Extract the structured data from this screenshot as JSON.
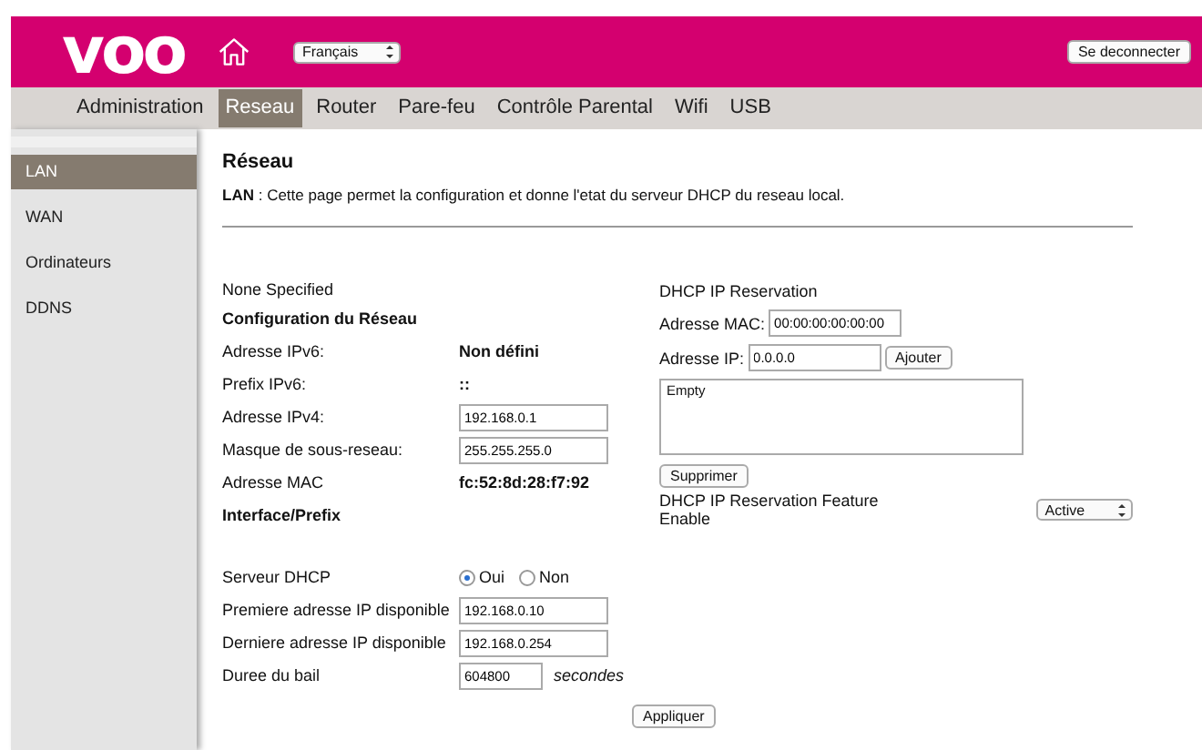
{
  "header": {
    "logo": "voo",
    "language": "Français",
    "logout": "Se deconnecter"
  },
  "tabs": [
    {
      "label": "Administration",
      "selected": false
    },
    {
      "label": "Reseau",
      "selected": true
    },
    {
      "label": "Router",
      "selected": false
    },
    {
      "label": "Pare-feu",
      "selected": false
    },
    {
      "label": "Contrôle Parental",
      "selected": false
    },
    {
      "label": "Wifi",
      "selected": false
    },
    {
      "label": "USB",
      "selected": false
    }
  ],
  "sidebar": {
    "items": [
      {
        "label": "LAN",
        "selected": true
      },
      {
        "label": "WAN",
        "selected": false
      },
      {
        "label": "Ordinateurs",
        "selected": false
      },
      {
        "label": "DDNS",
        "selected": false
      }
    ]
  },
  "page": {
    "title": "Réseau",
    "description": "**LAN**  :  Cette page permet la configuration et donne l'etat du serveur DHCP du reseau local."
  },
  "lan_form": [
    {
      "kind": "note",
      "label": "None Specified"
    },
    {
      "kind": "heading",
      "label": "Configuration du Réseau"
    },
    {
      "kind": "value",
      "label": "Adresse IPv6:",
      "value": "Non défini"
    },
    {
      "kind": "value",
      "label": "Prefix IPv6:",
      "value": "::"
    },
    {
      "kind": "input",
      "label": "Adresse IPv4:",
      "value": "192.168.0.1"
    },
    {
      "kind": "input",
      "label": "Masque de sous-reseau:",
      "value": "255.255.255.0"
    },
    {
      "kind": "value",
      "label": "Adresse MAC",
      "value": "fc:52:8d:28:f7:92"
    },
    {
      "kind": "heading",
      "label": "Interface/Prefix"
    },
    {
      "kind": "spacer"
    },
    {
      "kind": "radio",
      "label": "Serveur DHCP",
      "options": [
        {
          "label": "Oui",
          "selected": true
        },
        {
          "label": "Non",
          "selected": false
        }
      ]
    },
    {
      "kind": "input",
      "label": "Premiere adresse IP disponible",
      "value": "192.168.0.10"
    },
    {
      "kind": "input",
      "label": "Derniere adresse IP disponible",
      "value": "192.168.0.254"
    },
    {
      "kind": "input_unit",
      "label": "Duree du bail",
      "value": "604800",
      "unit": "secondes"
    }
  ],
  "reservation": {
    "title": "DHCP IP Reservation",
    "mac_label": "Adresse MAC:",
    "mac_value": "00:00:00:00:00:00",
    "ip_label": "Adresse IP:",
    "ip_value": "0.0.0.0",
    "add_button": "Ajouter",
    "list_text": "Empty",
    "delete_button": "Supprimer",
    "feature_label": "DHCP IP Reservation Feature Enable",
    "feature_value": "Active"
  },
  "apply_button": "Appliquer"
}
